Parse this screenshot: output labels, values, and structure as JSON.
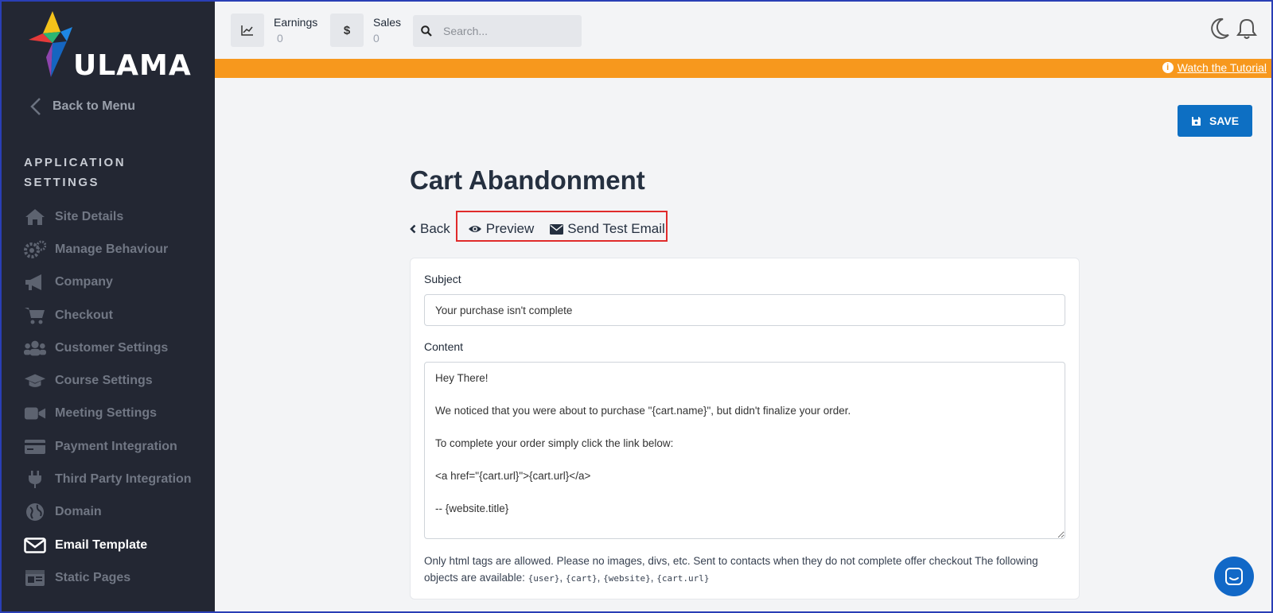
{
  "brand": {
    "name": "ULAMA"
  },
  "sidebar": {
    "back_label": "Back to Menu",
    "section_title": "APPLICATION SETTINGS",
    "items": [
      {
        "label": "Site Details",
        "icon": "home-icon"
      },
      {
        "label": "Manage Behaviour",
        "icon": "gears-icon"
      },
      {
        "label": "Company",
        "icon": "megaphone-icon"
      },
      {
        "label": "Checkout",
        "icon": "cart-icon"
      },
      {
        "label": "Customer Settings",
        "icon": "users-icon"
      },
      {
        "label": "Course Settings",
        "icon": "graduation-cap-icon"
      },
      {
        "label": "Meeting Settings",
        "icon": "video-icon"
      },
      {
        "label": "Payment Integration",
        "icon": "credit-card-icon"
      },
      {
        "label": "Third Party Integration",
        "icon": "plug-icon"
      },
      {
        "label": "Domain",
        "icon": "globe-icon"
      },
      {
        "label": "Email Template",
        "icon": "envelope-icon",
        "active": true
      },
      {
        "label": "Static Pages",
        "icon": "page-icon"
      }
    ]
  },
  "topbar": {
    "earnings_label": "Earnings",
    "earnings_value": "0",
    "sales_label": "Sales",
    "sales_value": "0",
    "search_placeholder": "Search..."
  },
  "banner": {
    "tutorial_label": "Watch the Tutorial",
    "color": "#f7981d"
  },
  "toolbar": {
    "save_label": "SAVE"
  },
  "page": {
    "title": "Cart Abandonment",
    "back_label": "Back",
    "preview_label": "Preview",
    "send_test_label": "Send Test Email"
  },
  "form": {
    "subject_label": "Subject",
    "subject_value": "Your purchase isn't complete",
    "content_label": "Content",
    "content_value": "Hey There!\n\nWe noticed that you were about to purchase \"{cart.name}\", but didn't finalize your order.\n\nTo complete your order simply click the link below:\n\n<a href=\"{cart.url}\">{cart.url}</a>\n\n-- {website.title}",
    "help_text": "Only html tags are allowed. Please no images, divs, etc. Sent to contacts when they do not complete offer checkout The following objects are available:",
    "objects": [
      "{user}",
      "{cart}",
      "{website}",
      "{cart.url}"
    ]
  },
  "colors": {
    "accent": "#0d6fc3",
    "sidebar_bg": "#232733",
    "highlight": "#e02b2b"
  }
}
